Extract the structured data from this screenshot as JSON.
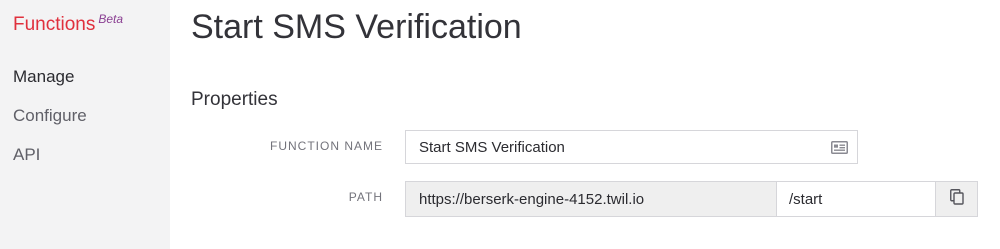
{
  "sidebar": {
    "brand": "Functions",
    "badge": "Beta",
    "items": [
      {
        "label": "Manage"
      },
      {
        "label": "Configure"
      },
      {
        "label": "API"
      }
    ]
  },
  "page": {
    "title": "Start SMS Verification",
    "section": "Properties"
  },
  "fields": {
    "function_name": {
      "label": "FUNCTION NAME",
      "value": "Start SMS Verification",
      "icon": "contact-card-icon"
    },
    "path": {
      "label": "PATH",
      "base_url": "https://berserk-engine-4152.twil.io",
      "value": "/start",
      "copy_icon": "copy-icon"
    }
  },
  "colors": {
    "brand": "#e0303d",
    "badge": "#8a3f92",
    "sidebar_bg": "#f3f3f4"
  }
}
